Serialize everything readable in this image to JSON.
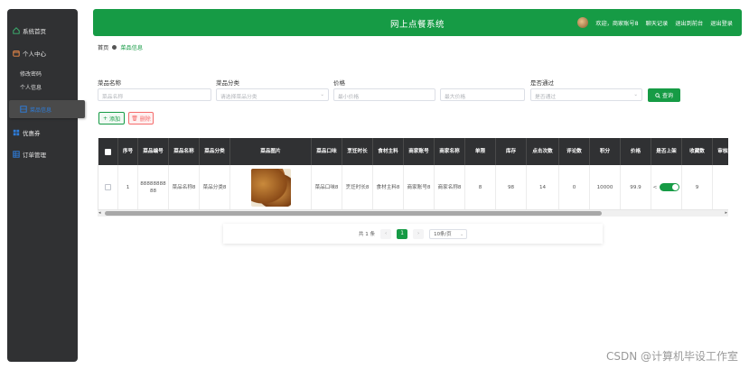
{
  "app": {
    "title": "网上点餐系统"
  },
  "header": {
    "welcome": "欢迎，商家账号8",
    "links": [
      "聊天记录",
      "退出到前台",
      "退出登录"
    ]
  },
  "sidebar": {
    "items": [
      {
        "label": "系统首页",
        "icon": "home-icon"
      },
      {
        "label": "个人中心",
        "icon": "user-center-icon"
      },
      {
        "label": "修改密码"
      },
      {
        "label": "个人信息"
      },
      {
        "label": "菜品信息",
        "icon": "food-icon",
        "active": true
      },
      {
        "label": "优惠券",
        "icon": "coupon-icon"
      },
      {
        "label": "订单管理",
        "icon": "order-icon"
      }
    ]
  },
  "breadcrumb": {
    "home": "首页",
    "current": "菜品信息"
  },
  "filters": {
    "name": {
      "label": "菜品名称",
      "placeholder": "菜品名称"
    },
    "category": {
      "label": "菜品分类",
      "placeholder": "请选择菜品分类"
    },
    "price": {
      "label": "价格",
      "min_placeholder": "最小价格",
      "max_placeholder": "最大价格"
    },
    "approval": {
      "label": "是否通过",
      "placeholder": "是否通过"
    },
    "query_label": "查询"
  },
  "actions": {
    "add_label": "添加",
    "delete_label": "删除"
  },
  "table": {
    "headers": [
      "序号",
      "菜品编号",
      "菜品名称",
      "菜品分类",
      "菜品图片",
      "菜品口味",
      "烹饪时长",
      "食材主料",
      "商家账号",
      "商家名称",
      "单限",
      "库存",
      "点击次数",
      "评论数",
      "积分",
      "价格",
      "是否上架",
      "收藏数",
      "审核回复"
    ],
    "rows": [
      [
        "1",
        "8888888888",
        "菜品名称8",
        "菜品分类8",
        "",
        "菜品口味8",
        "烹饪时长8",
        "食材主料8",
        "商家账号8",
        "商家名称8",
        "8",
        "98",
        "14",
        "0",
        "10000",
        "99.9",
        "",
        "9",
        ""
      ]
    ]
  },
  "pagination": {
    "total": "共 1 条",
    "current": "1",
    "page_size": "10条/页"
  },
  "watermark": "CSDN @计算机毕设工作室",
  "colors": {
    "primary": "#169b45",
    "sidebar": "#303133",
    "danger": "#f56c6c"
  }
}
